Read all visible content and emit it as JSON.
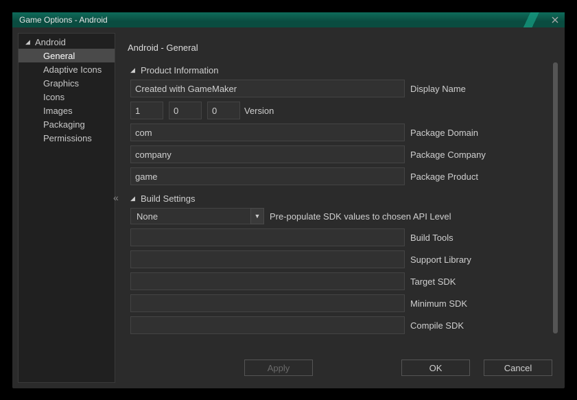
{
  "window": {
    "title": "Game Options - Android"
  },
  "sidebar": {
    "root": "Android",
    "items": [
      {
        "label": "General",
        "selected": true
      },
      {
        "label": "Adaptive Icons"
      },
      {
        "label": "Graphics"
      },
      {
        "label": "Icons"
      },
      {
        "label": "Images"
      },
      {
        "label": "Packaging"
      },
      {
        "label": "Permissions"
      }
    ]
  },
  "page": {
    "title": "Android - General"
  },
  "sections": {
    "product": {
      "header": "Product Information",
      "display_name_label": "Display Name",
      "display_name_value": "Created with GameMaker",
      "version_label": "Version",
      "version_major": "1",
      "version_minor": "0",
      "version_patch": "0",
      "package_domain_label": "Package Domain",
      "package_domain_value": "com",
      "package_company_label": "Package Company",
      "package_company_value": "company",
      "package_product_label": "Package Product",
      "package_product_value": "game"
    },
    "build": {
      "header": "Build Settings",
      "sdk_preset_label": "Pre-populate SDK values to chosen API Level",
      "sdk_preset_value": "None",
      "build_tools_label": "Build Tools",
      "build_tools_value": "",
      "support_library_label": "Support Library",
      "support_library_value": "",
      "target_sdk_label": "Target SDK",
      "target_sdk_value": "",
      "minimum_sdk_label": "Minimum SDK",
      "minimum_sdk_value": "",
      "compile_sdk_label": "Compile SDK",
      "compile_sdk_value": ""
    }
  },
  "buttons": {
    "apply": "Apply",
    "ok": "OK",
    "cancel": "Cancel"
  },
  "collapse": "«"
}
